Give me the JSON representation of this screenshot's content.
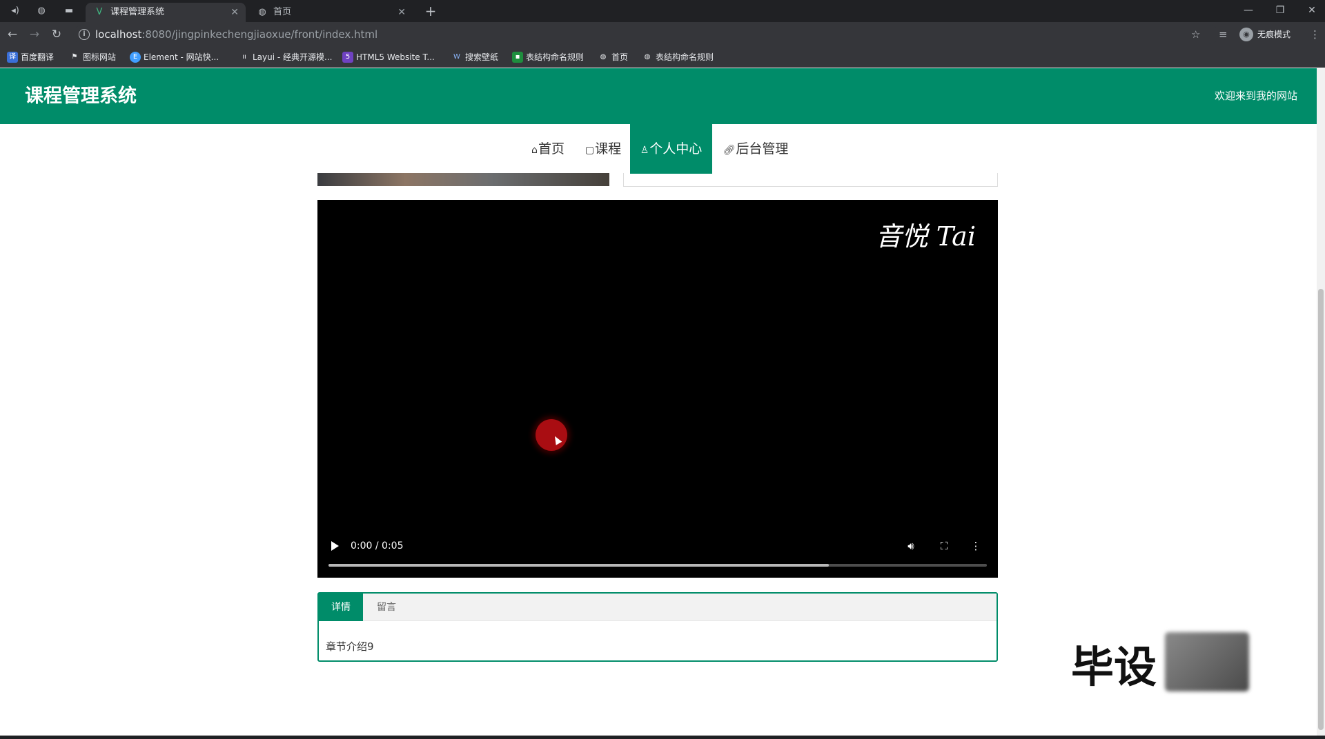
{
  "browser": {
    "tabs": [
      {
        "title": "课程管理系统",
        "active": true,
        "icon": "vue-logo-icon"
      },
      {
        "title": "首页",
        "active": false,
        "icon": "globe-icon"
      }
    ],
    "url_host": "localhost",
    "url_rest": ":8080/jingpinkechengjiaoxue/front/index.html",
    "profile_label": "无痕模式",
    "bookmarks": [
      "百度翻译",
      "图标网站",
      "Element - 网站快...",
      "Layui - 经典开源模...",
      "HTML5 Website T...",
      "搜索壁纸",
      "表结构命名规则",
      "首页",
      "表结构命名规则"
    ]
  },
  "site": {
    "title": "课程管理系统",
    "welcome": "欢迎来到我的网站",
    "nav": [
      {
        "label": "首页",
        "icon": "home-icon",
        "active": false
      },
      {
        "label": "课程",
        "icon": "book-icon",
        "active": false
      },
      {
        "label": "个人中心",
        "icon": "user-icon",
        "active": true
      },
      {
        "label": "后台管理",
        "icon": "link-icon",
        "active": false
      }
    ]
  },
  "video": {
    "watermark": "音悦 Tai",
    "time": "0:00 / 0:05",
    "buffered": 0.76
  },
  "content_tabs": {
    "tabs": [
      {
        "label": "详情",
        "active": true
      },
      {
        "label": "留言",
        "active": false
      }
    ],
    "detail_text": "章节介绍9"
  },
  "overlay": {
    "watermark_text": "毕设"
  },
  "colors": {
    "brand": "#008c69",
    "chrome_dark": "#202124",
    "chrome_toolbar": "#35363a"
  }
}
